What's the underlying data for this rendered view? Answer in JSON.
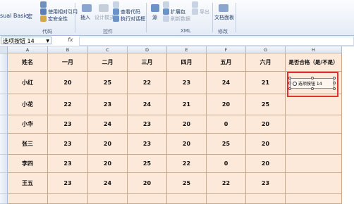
{
  "ribbon": {
    "left_partial": "sual Basic",
    "left_items": [
      "宏",
      "使用相对引用",
      "宏安全性"
    ],
    "controls_items": [
      "插入",
      "设计模式",
      "查看代码",
      "执行对话框"
    ],
    "xml_items": [
      "源",
      "扩展包",
      "导出",
      "刷新数据"
    ],
    "modify_items": [
      "文档面板"
    ],
    "groups": {
      "code": "代码",
      "controls": "控件",
      "xml": "XML",
      "modify": "修改"
    }
  },
  "formula_bar": {
    "name_box": "选项按钮 14",
    "fx": "fx"
  },
  "columns": [
    "A",
    "B",
    "C",
    "D",
    "E",
    "F",
    "G",
    "H"
  ],
  "table": {
    "headers": [
      "姓名",
      "一月",
      "二月",
      "三月",
      "四月",
      "五月",
      "六月",
      "是否合格（是/不是）"
    ],
    "rows": [
      [
        "小红",
        "20",
        "25",
        "22",
        "23",
        "24",
        "21"
      ],
      [
        "小花",
        "22",
        "23",
        "24",
        "21",
        "20",
        "25"
      ],
      [
        "小华",
        "23",
        "24",
        "23",
        "20",
        "0",
        "20"
      ],
      [
        "张三",
        "23",
        "20",
        "23",
        "20",
        "25",
        "20"
      ],
      [
        "李四",
        "23",
        "20",
        "25",
        "22",
        "0",
        "20"
      ],
      [
        "王五",
        "23",
        "24",
        "20",
        "25",
        "22",
        "23"
      ]
    ]
  },
  "option_control": {
    "label": "选项按钮 14"
  },
  "colors": {
    "cell_fill": "#fde9d9",
    "highlight_border": "#e23131"
  }
}
